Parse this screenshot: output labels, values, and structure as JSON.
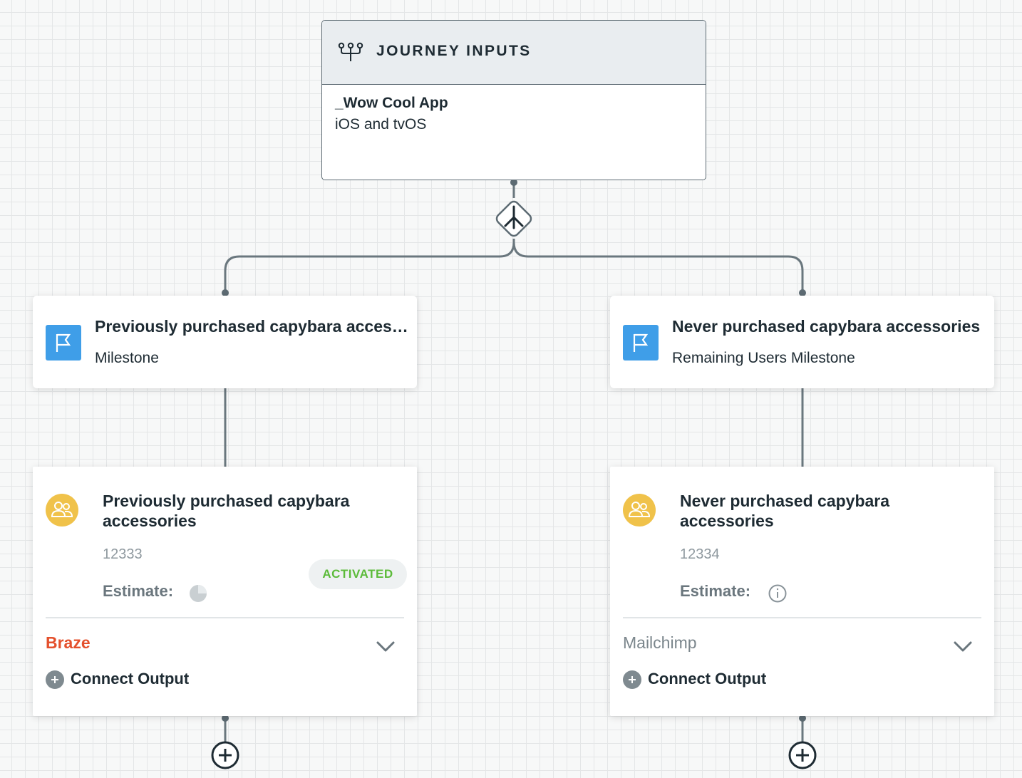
{
  "journey_inputs": {
    "title": "JOURNEY INPUTS",
    "app_name": "_Wow Cool App",
    "platforms": "iOS and tvOS"
  },
  "branches": [
    {
      "milestone": {
        "title": "Previously purchased capybara accessories",
        "subtitle": "Milestone"
      },
      "segment": {
        "title": "Previously purchased capybara accessories",
        "id": "12333",
        "estimate_label": "Estimate:",
        "status": "ACTIVATED",
        "destination": "Braze",
        "connect_label": "Connect Output"
      }
    },
    {
      "milestone": {
        "title": "Never purchased capybara accessories",
        "subtitle": "Remaining Users Milestone"
      },
      "segment": {
        "title": "Never purchased capybara accessories",
        "id": "12334",
        "estimate_label": "Estimate:",
        "destination": "Mailchimp",
        "connect_label": "Connect Output"
      }
    }
  ],
  "icons": {
    "journey": "journey-inputs-icon",
    "split": "split-icon",
    "milestone": "flag-icon",
    "segment": "audience-icon",
    "estimate_pending": "loading-pie-icon",
    "estimate_info": "info-icon",
    "expand": "chevron-down-icon",
    "connect": "plus-circle-icon",
    "add_step": "add-step-icon"
  },
  "colors": {
    "accent_blue": "#3f9ee8",
    "segment_yellow": "#f0c24a",
    "activated_green": "#5cbb3a",
    "braze_orange": "#e4502c",
    "connector": "#5d6b73"
  }
}
